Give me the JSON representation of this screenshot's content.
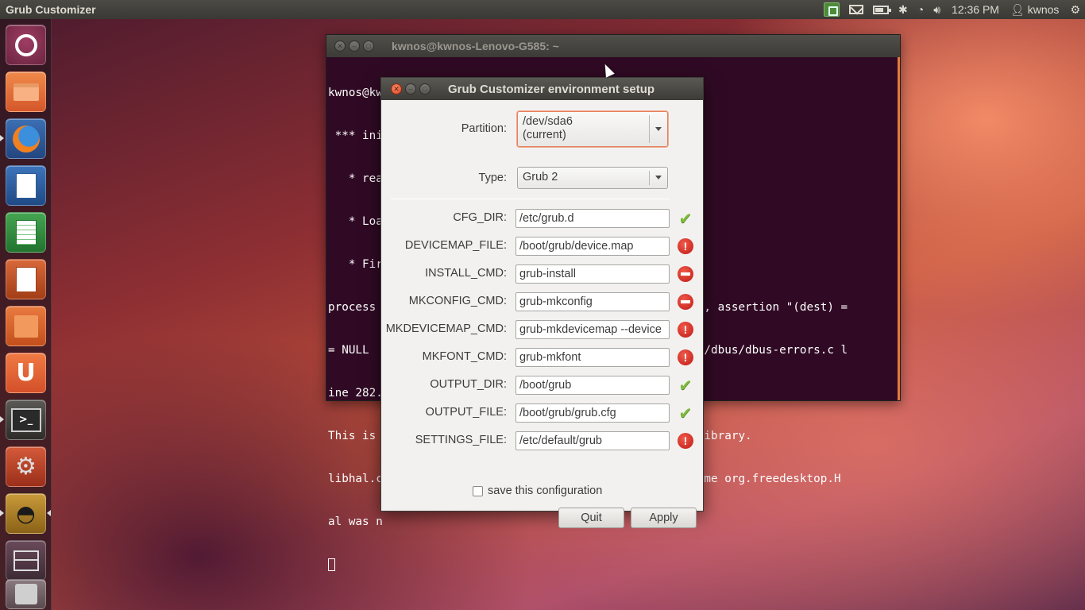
{
  "panel": {
    "app_title": "Grub Customizer",
    "clock": "12:36 PM",
    "user": "kwnos"
  },
  "launcher": {
    "items": [
      {
        "name": "ubuntu-dash",
        "color": "#7a2d4a"
      },
      {
        "name": "files",
        "color": "#e0632e"
      },
      {
        "name": "firefox",
        "color": "#2e5f9e"
      },
      {
        "name": "libreoffice-writer",
        "color": "#2c5e9c"
      },
      {
        "name": "libreoffice-calc",
        "color": "#2e8a3a"
      },
      {
        "name": "libreoffice-impress",
        "color": "#b44a1f"
      },
      {
        "name": "software-center",
        "color": "#d9602b"
      },
      {
        "name": "ubuntu-one",
        "color": "#e0632e"
      },
      {
        "name": "terminal",
        "color": "#3c3b37"
      },
      {
        "name": "system-settings",
        "color": "#c7452a"
      },
      {
        "name": "grub-customizer",
        "color": "#b08a2a"
      },
      {
        "name": "workspace-switcher",
        "color": "#5b3a4a"
      },
      {
        "name": "trash",
        "color": "#6a5a5f"
      }
    ]
  },
  "terminal": {
    "title": "kwnos@kwnos-Lenovo-G585: ~",
    "lines": [
      "kwnos@kwnos-Lenovo-G585:~$ sudo grub-customizer",
      " *** initializing (w/o specified bootloader type)",
      "   * rea",
      "   * Loa                                         ess)",
      "   * Fir",
      "process                                         correct, assertion \"(dest) =",
      "= NULL                                          e ../../dbus/dbus-errors.c l",
      "ine 282.",
      "This is                                         D-Bus library.",
      "libhal.c                                        =The name org.freedesktop.H",
      "al was n"
    ]
  },
  "dialog": {
    "title": "Grub Customizer environment setup",
    "partition_label": "Partition:",
    "partition_value_line1": "/dev/sda6",
    "partition_value_line2": "(current)",
    "type_label": "Type:",
    "type_value": "Grub 2",
    "fields": [
      {
        "label": "CFG_DIR:",
        "value": "/etc/grub.d",
        "status": "ok"
      },
      {
        "label": "DEVICEMAP_FILE:",
        "value": "/boot/grub/device.map",
        "status": "error"
      },
      {
        "label": "INSTALL_CMD:",
        "value": "grub-install",
        "status": "stop"
      },
      {
        "label": "MKCONFIG_CMD:",
        "value": "grub-mkconfig",
        "status": "stop"
      },
      {
        "label": "MKDEVICEMAP_CMD:",
        "value": "grub-mkdevicemap --device",
        "status": "error"
      },
      {
        "label": "MKFONT_CMD:",
        "value": "grub-mkfont",
        "status": "error"
      },
      {
        "label": "OUTPUT_DIR:",
        "value": "/boot/grub",
        "status": "ok"
      },
      {
        "label": "OUTPUT_FILE:",
        "value": "/boot/grub/grub.cfg",
        "status": "ok"
      },
      {
        "label": "SETTINGS_FILE:",
        "value": "/etc/default/grub",
        "status": "error"
      }
    ],
    "save_label": "save this configuration",
    "save_checked": false,
    "quit_label": "Quit",
    "apply_label": "Apply"
  }
}
